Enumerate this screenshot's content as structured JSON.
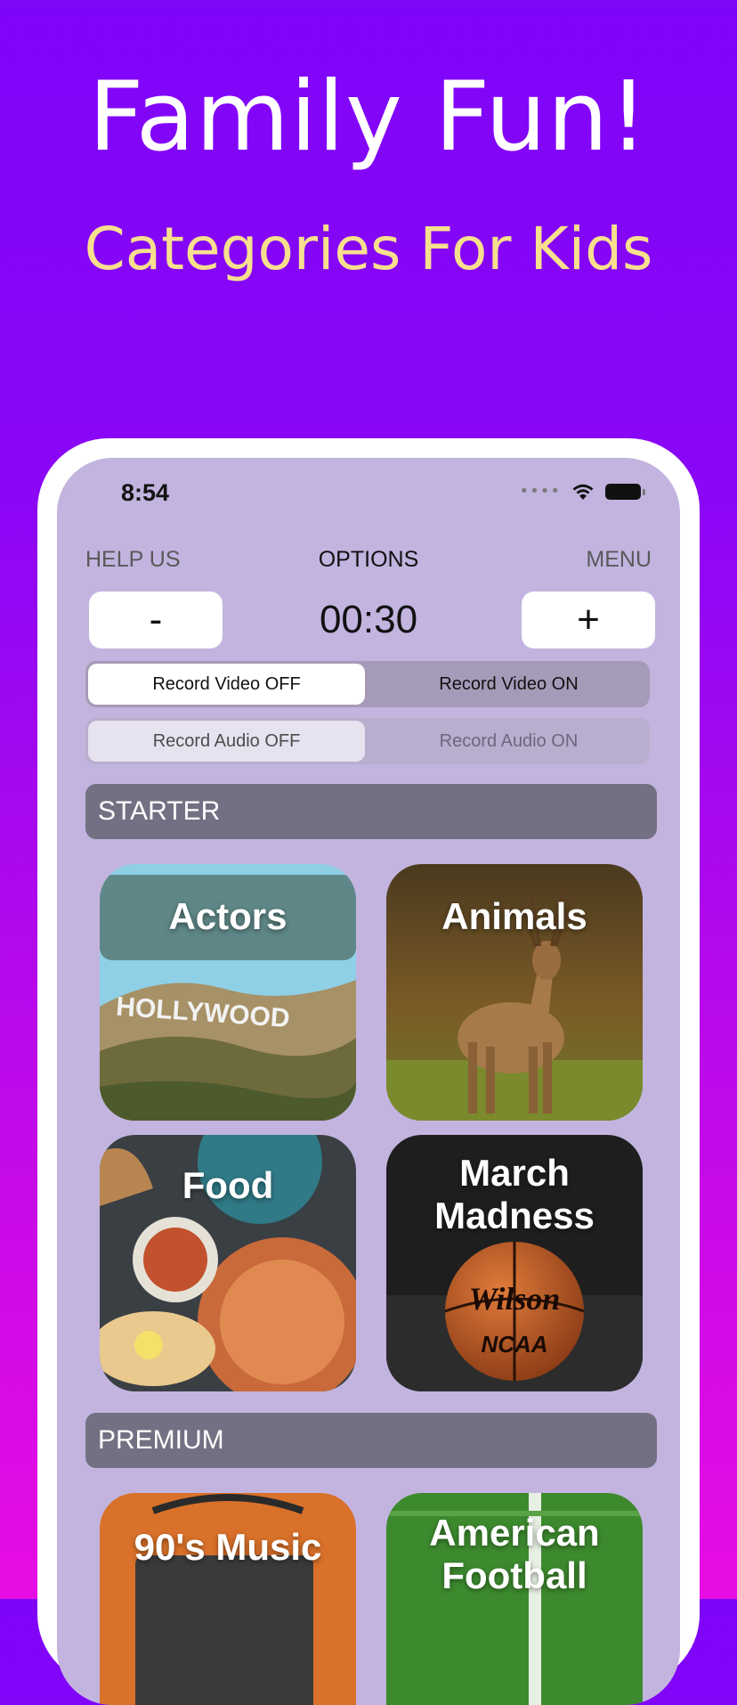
{
  "promo": {
    "headline": "Family Fun!",
    "subheadline": "Categories For Kids"
  },
  "status_bar": {
    "time": "8:54",
    "signal_icon": "signal-dots-icon",
    "wifi_icon": "wifi-icon",
    "battery_icon": "battery-icon"
  },
  "nav": {
    "left": "HELP US",
    "center": "OPTIONS",
    "right": "MENU"
  },
  "timer": {
    "decrement": "-",
    "value": "00:30",
    "increment": "+"
  },
  "record_video": {
    "off": "Record Video OFF",
    "on": "Record Video ON",
    "selected": "off"
  },
  "record_audio": {
    "off": "Record Audio OFF",
    "on": "Record Audio ON",
    "selected": "off"
  },
  "sections": {
    "starter": "STARTER",
    "premium": "PREMIUM"
  },
  "cards": {
    "actors": "Actors",
    "actors_sign": "HOLLYWOOD",
    "animals": "Animals",
    "food": "Food",
    "march_line1": "March",
    "march_line2": "Madness",
    "ball_brand": "Wilson",
    "ball_mark": "NCAA",
    "music": "90's Music",
    "football_line1": "American",
    "football_line2": "Football"
  },
  "colors": {
    "background_top": "#7f05f8",
    "background_bottom": "#e80ce4",
    "subheadline": "#f7df8e",
    "screen_bg": "#c2b4df",
    "section_header_bg": "#737083"
  }
}
